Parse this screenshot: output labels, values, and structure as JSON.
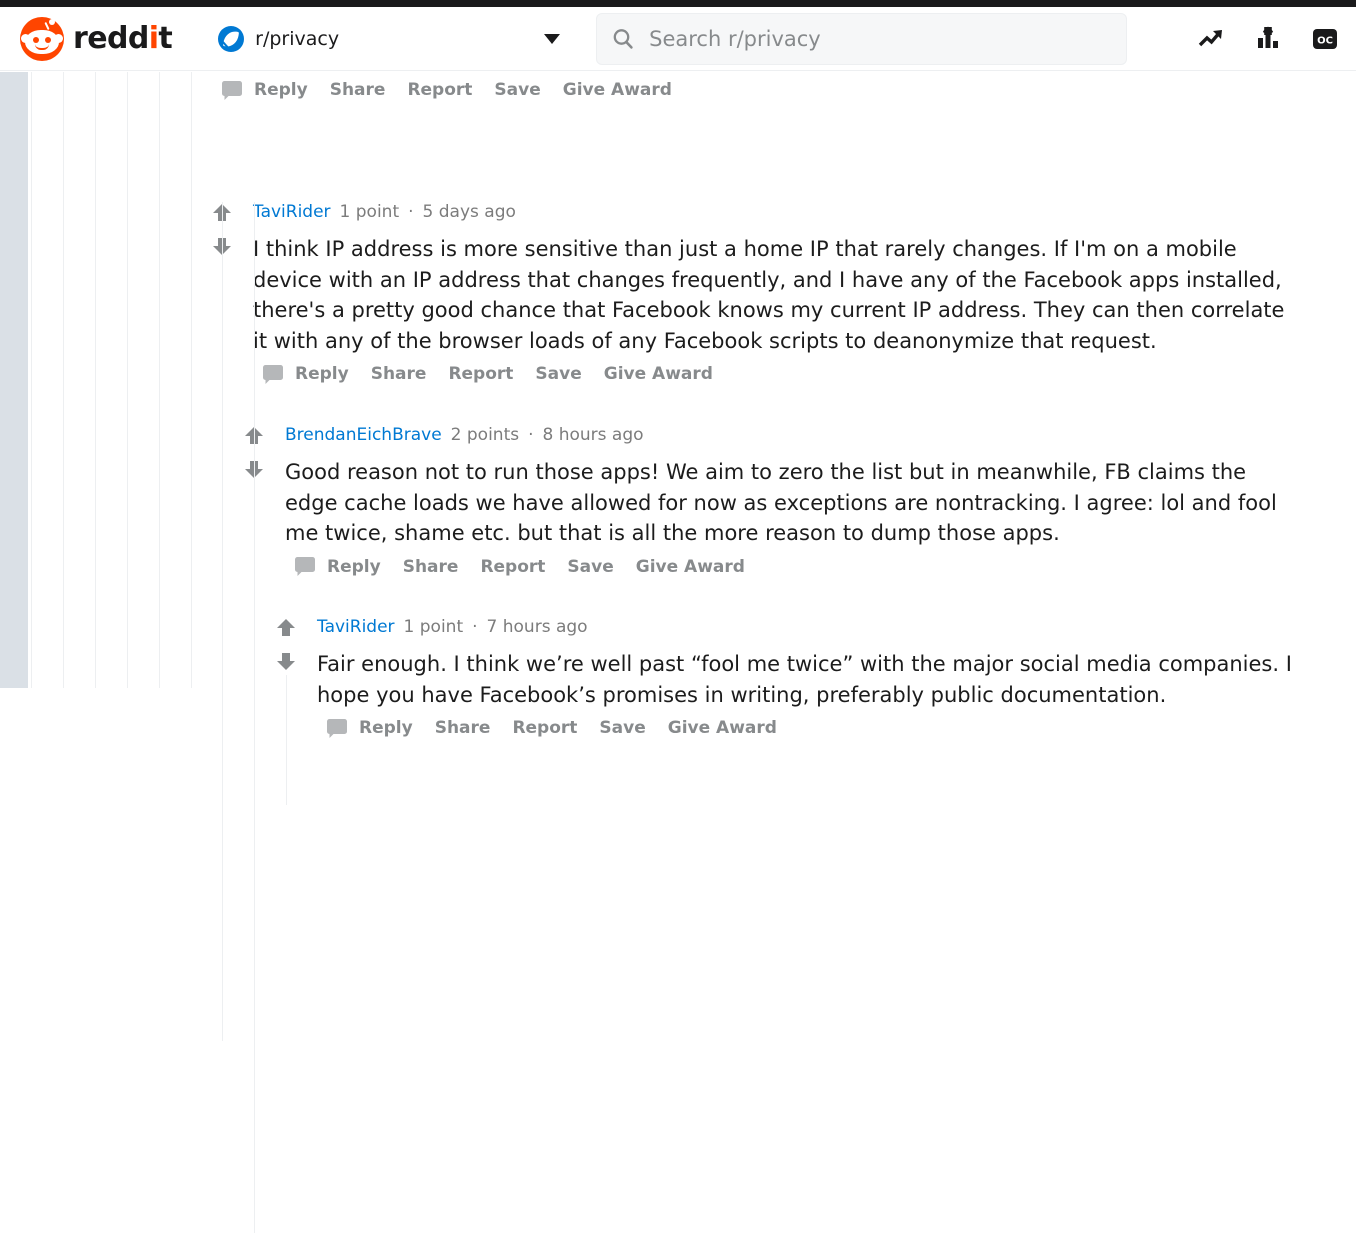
{
  "header": {
    "logo_text_1": "redd",
    "logo_text_dot": "i",
    "logo_text_2": "t",
    "logo_alt": "reddit",
    "subreddit": "r/privacy",
    "search_placeholder": "Search r/privacy",
    "search_value": "",
    "icons": [
      {
        "name": "trending-icon",
        "label": "Trending"
      },
      {
        "name": "bar-chart-up-icon",
        "label": "Best"
      },
      {
        "name": "oc-badge-icon",
        "label": "OC"
      }
    ],
    "colors": {
      "brand_orange": "#ff4500",
      "link_blue": "#0079d3",
      "top_strip": "#1a1a1b",
      "page_band": "#dae0e6"
    }
  },
  "partial_top_actions": {
    "items": [
      "Reply",
      "Share",
      "Report",
      "Save",
      "Give Award"
    ]
  },
  "comments": [
    {
      "author": "TaviRider",
      "points": "1 point",
      "separator": "·",
      "time": "5 days ago",
      "body": "I think IP address is more sensitive than just a home IP that rarely changes. If I'm on a mobile device with an IP address that changes frequently, and I have any of the Facebook apps installed, there's a pretty good chance that Facebook knows my current IP address. They can then correlate it with any of the browser loads of any Facebook scripts to deanonymize that request.",
      "actions": [
        "Reply",
        "Share",
        "Report",
        "Save",
        "Give Award"
      ],
      "depth": 7
    },
    {
      "author": "BrendanEichBrave",
      "points": "2 points",
      "separator": "·",
      "time": "8 hours ago",
      "body": "Good reason not to run those apps! We aim to zero the list but in meanwhile, FB claims the edge cache loads we have allowed for now as exceptions are nontracking. I agree: lol and fool me twice, shame etc. but that is all the more reason to dump those apps.",
      "actions": [
        "Reply",
        "Share",
        "Report",
        "Save",
        "Give Award"
      ],
      "depth": 8
    },
    {
      "author": "TaviRider",
      "points": "1 point",
      "separator": "·",
      "time": "7 hours ago",
      "body": "Fair enough. I think we’re well past “fool me twice” with the major social media companies. I hope you have Facebook’s promises in writing, preferably public documentation.",
      "actions": [
        "Reply",
        "Share",
        "Report",
        "Save",
        "Give Award"
      ],
      "depth": 9
    }
  ]
}
